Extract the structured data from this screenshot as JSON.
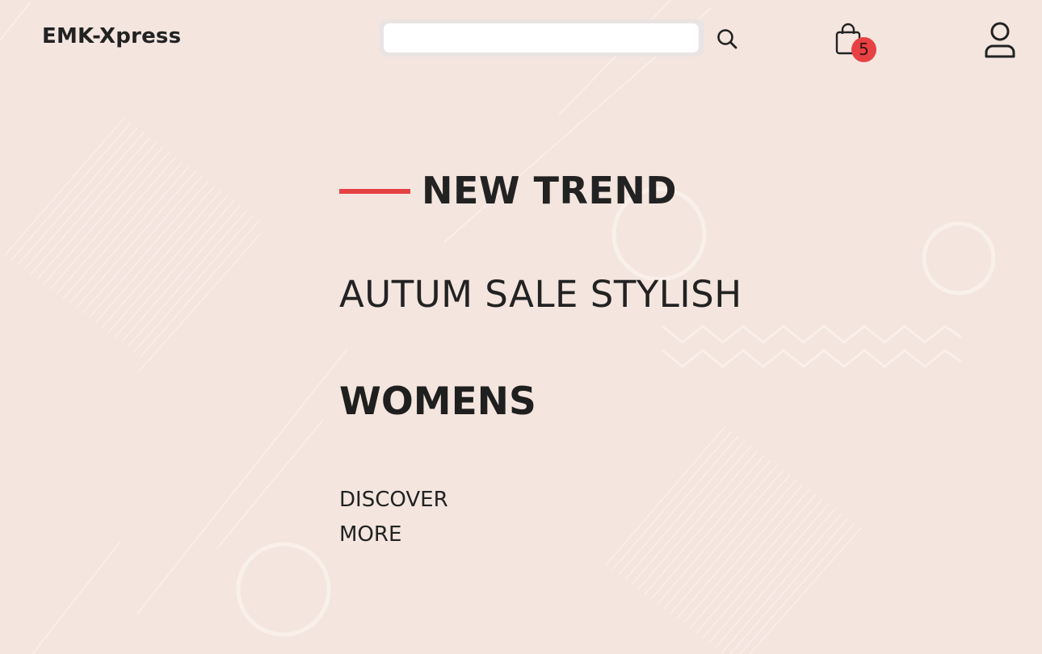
{
  "header": {
    "brand": "EMK-Xpress",
    "search": {
      "value": "",
      "placeholder": ""
    },
    "search_icon": "search-icon",
    "cart": {
      "icon": "shopping-bag-icon",
      "count": "5"
    },
    "account_icon": "user-icon"
  },
  "hero": {
    "eyebrow": "NEW TREND",
    "subtitle": "AUTUM SALE STYLISH",
    "headline": "WOMENS",
    "cta": {
      "line1": "DISCOVER",
      "line2": "MORE"
    }
  },
  "colors": {
    "background": "#f4e5df",
    "accent": "#e64243",
    "text": "#222222",
    "decoration": "#faf0ea"
  }
}
